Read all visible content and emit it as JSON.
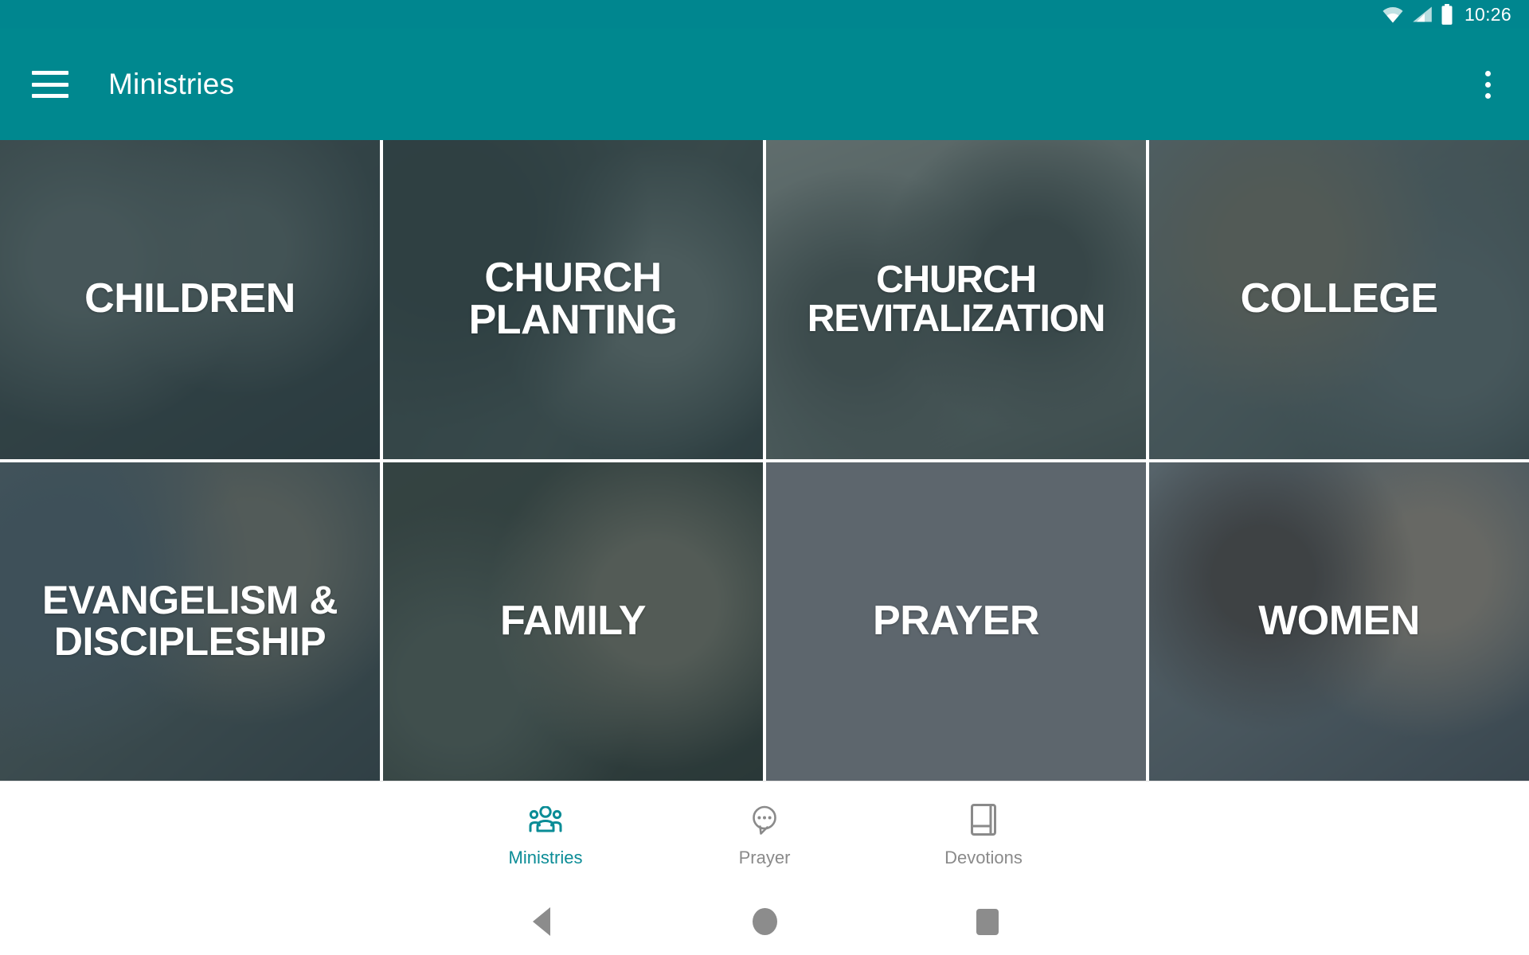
{
  "statusbar": {
    "time": "10:26",
    "icons": [
      "wifi-icon",
      "cellular-signal-icon",
      "battery-icon"
    ]
  },
  "appbar": {
    "title": "Ministries",
    "menu_icon": "hamburger-menu-icon",
    "overflow_icon": "overflow-menu-icon",
    "background_color": "#00888f",
    "text_color": "#ffffff"
  },
  "grid": {
    "columns": 4,
    "rows": 2,
    "tiles": [
      {
        "label": "CHILDREN",
        "size": "normal",
        "scrim": "rgba(38,56,60,0.72)"
      },
      {
        "label": "CHURCH\nPLANTING",
        "size": "normal",
        "scrim": "rgba(38,56,60,0.74)"
      },
      {
        "label": "CHURCH\nREVITALIZATION",
        "size": "xwide",
        "scrim": "rgba(44,60,62,0.66)"
      },
      {
        "label": "COLLEGE",
        "size": "normal",
        "scrim": "rgba(40,58,62,0.70)"
      },
      {
        "label": "EVANGELISM &\nDISCIPLESHIP",
        "size": "wide",
        "scrim": "rgba(42,58,64,0.70)"
      },
      {
        "label": "FAMILY",
        "size": "normal",
        "scrim": "rgba(40,56,56,0.72)"
      },
      {
        "label": "PRAYER",
        "size": "normal",
        "scrim": "rgba(36,48,58,0.74)"
      },
      {
        "label": "WOMEN",
        "size": "normal",
        "scrim": "rgba(44,58,66,0.62)"
      }
    ]
  },
  "bottomnav": {
    "active_color": "#0a8c96",
    "inactive_color": "#8a8a8a",
    "items": [
      {
        "label": "Ministries",
        "icon": "group-people-icon",
        "active": true
      },
      {
        "label": "Prayer",
        "icon": "chat-bubble-icon",
        "active": false
      },
      {
        "label": "Devotions",
        "icon": "book-icon",
        "active": false
      }
    ]
  },
  "sysnav": {
    "buttons": [
      {
        "name": "back",
        "icon": "back-triangle-icon"
      },
      {
        "name": "home",
        "icon": "home-circle-icon"
      },
      {
        "name": "recent",
        "icon": "recents-square-icon"
      }
    ]
  }
}
